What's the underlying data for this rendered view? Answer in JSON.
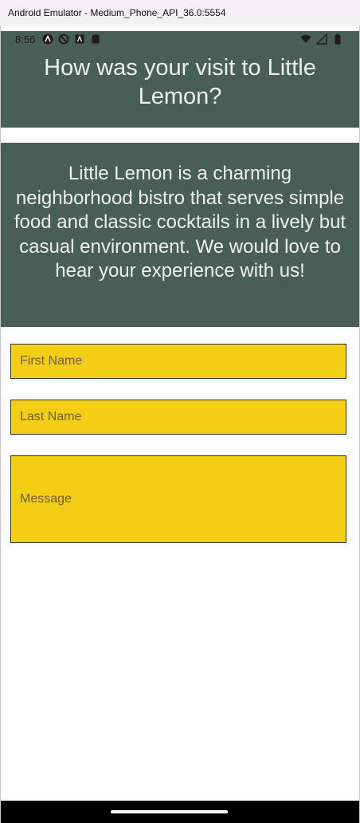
{
  "window": {
    "title": "Android Emulator - Medium_Phone_API_36.0:5554"
  },
  "status_bar": {
    "time": "8:56",
    "left_icons": [
      "app-notification-icon",
      "shield-icon",
      "text-icon",
      "sd-card-icon"
    ],
    "right_icons": [
      "wifi-icon",
      "signal-icon",
      "battery-icon"
    ]
  },
  "header": {
    "title": "How was your visit to Little Lemon?"
  },
  "description": {
    "text": "Little Lemon is a charming neighborhood bistro that serves simple food and classic cocktails in a lively but casual environment. We would love to hear your experience with us!"
  },
  "form": {
    "first_name_placeholder": "First Name",
    "last_name_placeholder": "Last Name",
    "message_placeholder": "Message"
  },
  "colors": {
    "header_bg": "#495e57",
    "text_light": "#edefee",
    "field_bg": "#f4ce14",
    "field_border": "#333333",
    "placeholder": "#6b6138"
  }
}
